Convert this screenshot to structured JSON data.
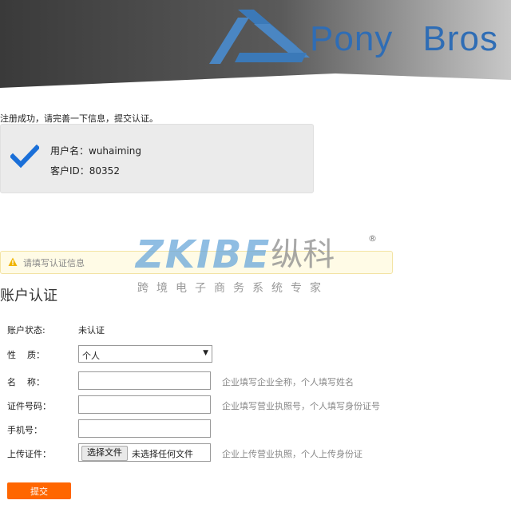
{
  "brand": {
    "name": "Pony  Bros"
  },
  "success": {
    "message": "注册成功，请完善一下信息，提交认证。",
    "username_line": "用户名：wuhaiming",
    "customer_id_line": "客户ID：80352"
  },
  "notice": {
    "text": "请填写认证信息"
  },
  "watermark": {
    "logo": "ZKIBE",
    "cn": "纵科",
    "reg": "®",
    "sub": "跨境电子商务系统专家"
  },
  "form": {
    "title": "账户认证",
    "status_label": "账户状态:",
    "status_value": "未认证",
    "nature_label": "性    质：",
    "nature_value": "个人",
    "name_label": "名    称：",
    "name_hint": "企业填写企业全称，个人填写姓名",
    "id_label": "证件号码：",
    "id_hint": "企业填写营业执照号，个人填写身份证号",
    "phone_label": "手机号：",
    "upload_label": "上传证件：",
    "file_button": "选择文件",
    "file_status": "未选择任何文件",
    "upload_hint": "企业上传营业执照，个人上传身份证",
    "submit_label": "提交"
  },
  "colors": {
    "brand_blue": "#2f6db5",
    "check_blue": "#1a6fd8",
    "submit_orange": "#ff6600"
  }
}
